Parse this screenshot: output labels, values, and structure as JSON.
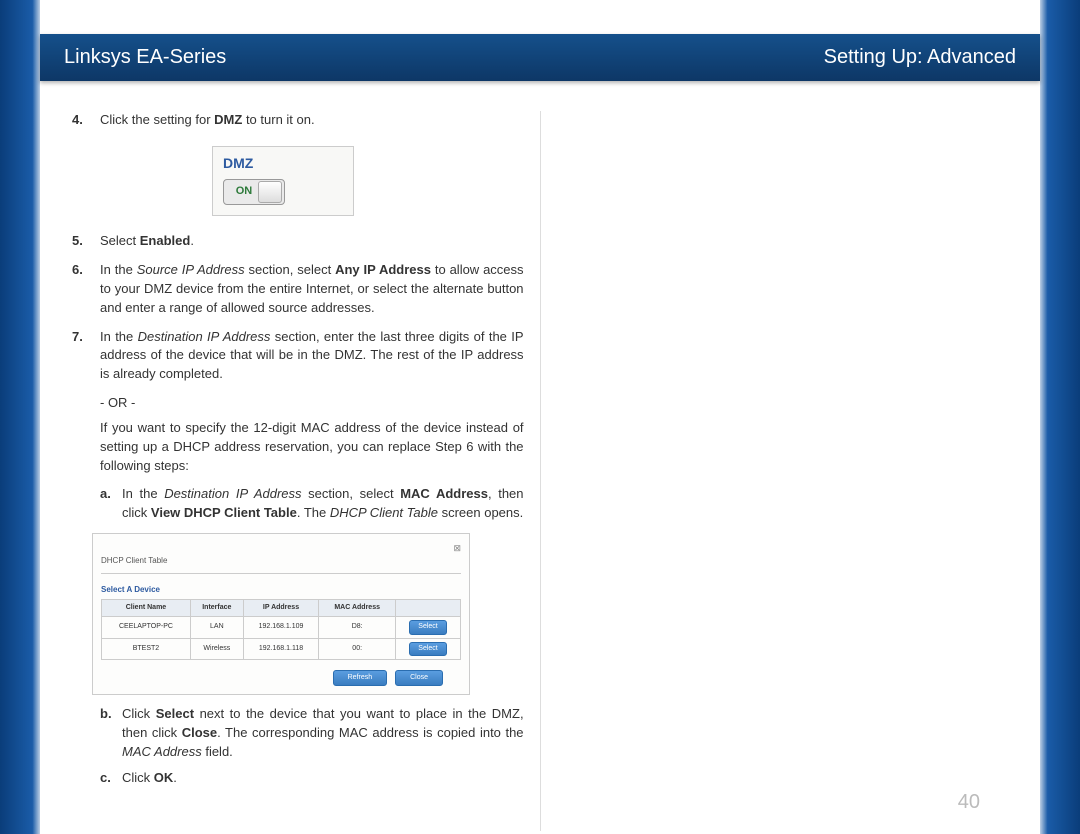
{
  "header": {
    "left": "Linksys EA-Series",
    "right": "Setting Up: Advanced"
  },
  "steps": {
    "s4": {
      "num": "4.",
      "pre": "Click the setting for ",
      "bold": "DMZ",
      "post": " to turn it on."
    },
    "s5": {
      "num": "5.",
      "pre": "Select ",
      "bold": "Enabled",
      "post": "."
    },
    "s6": {
      "num": "6.",
      "pre": "In the ",
      "italic": "Source IP Address",
      "mid": " section, select ",
      "bold": "Any IP Address",
      "post": " to allow access to your DMZ device from the entire Internet, or select the alternate button and enter a range of allowed source addresses."
    },
    "s7": {
      "num": "7.",
      "pre": "In the ",
      "italic": "Destination IP Address",
      "post": " section, enter the last three digits of the IP address of the device that will be in the DMZ. The rest of the IP address is already completed."
    }
  },
  "or": "- OR -",
  "follow": "If you want to specify the 12-digit MAC address of the device instead of setting up a DHCP address reservation, you can replace Step 6 with the following steps:",
  "substeps": {
    "a": {
      "num": "a.",
      "pre": "In the ",
      "i1": "Destination IP Address",
      "m1": " section, select ",
      "b1": "MAC Address",
      "m2": ", then click ",
      "b2": "View DHCP Client Table",
      "m3": ". The ",
      "i2": "DHCP Client Table",
      "post": " screen opens."
    },
    "b": {
      "num": "b.",
      "pre": "Click ",
      "b1": "Select",
      "m1": " next to the device that you want to place in the DMZ, then click ",
      "b2": "Close",
      "m2": ". The corresponding MAC address is copied into the ",
      "i1": "MAC Address",
      "post": " field."
    },
    "c": {
      "num": "c.",
      "pre": "Click ",
      "b1": "OK",
      "post": "."
    }
  },
  "dmz": {
    "label": "DMZ",
    "state": "ON"
  },
  "dhcp": {
    "title": "DHCP Client Table",
    "select_label": "Select A Device",
    "headers": [
      "Client Name",
      "Interface",
      "IP Address",
      "MAC Address",
      ""
    ],
    "rows": [
      {
        "name": "CEELAPTOP-PC",
        "iface": "LAN",
        "ip": "192.168.1.109",
        "mac": "D8:",
        "btn": "Select"
      },
      {
        "name": "BTEST2",
        "iface": "Wireless",
        "ip": "192.168.1.118",
        "mac": "00:",
        "btn": "Select"
      }
    ],
    "refresh": "Refresh",
    "close": "Close"
  },
  "page_number": "40"
}
